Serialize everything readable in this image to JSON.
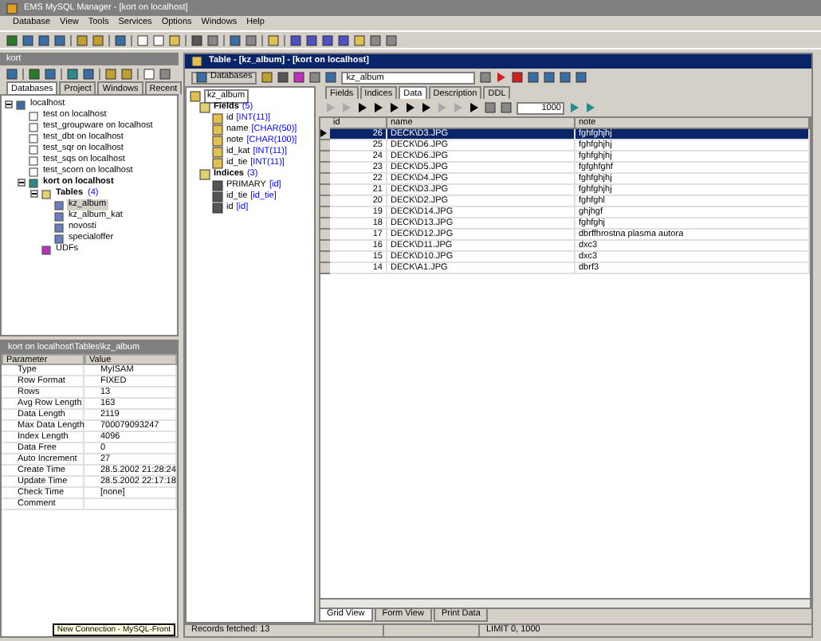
{
  "window": {
    "title": "EMS MySQL Manager - [kort on localhost]"
  },
  "menu": [
    "Database",
    "View",
    "Tools",
    "Services",
    "Options",
    "Windows",
    "Help"
  ],
  "explorer": {
    "title": "kort",
    "tabs": [
      {
        "label": "Databases",
        "selected": true
      },
      {
        "label": "Project",
        "selected": false
      },
      {
        "label": "Windows",
        "selected": false
      },
      {
        "label": "Recent",
        "selected": false
      }
    ],
    "tree": [
      {
        "label": "localhost",
        "kind": "host",
        "expanded": true,
        "selected": false,
        "children": [
          {
            "label": "test on localhost",
            "kind": "db",
            "selected": false
          },
          {
            "label": "test_groupware on localhost",
            "kind": "db",
            "selected": false
          },
          {
            "label": "test_dbt on localhost",
            "kind": "db",
            "selected": false
          },
          {
            "label": "test_sqr on localhost",
            "kind": "db",
            "selected": false
          },
          {
            "label": "test_sqs on localhost",
            "kind": "db",
            "selected": false
          },
          {
            "label": "test_scorn on localhost",
            "kind": "db",
            "selected": false
          },
          {
            "label": "kort on localhost",
            "kind": "active-db",
            "expanded": true,
            "selected": false,
            "children": [
              {
                "label": "Tables",
                "count": "(4)",
                "kind": "folder",
                "expanded": true,
                "selected": false,
                "children": [
                  {
                    "label": "kz_album",
                    "kind": "table",
                    "selected": true
                  },
                  {
                    "label": "kz_album_kat",
                    "kind": "table",
                    "selected": false
                  },
                  {
                    "label": "novosti",
                    "kind": "table",
                    "selected": false
                  },
                  {
                    "label": "specialoffer",
                    "kind": "table",
                    "selected": false
                  }
                ]
              },
              {
                "label": "UDFs",
                "kind": "udf",
                "selected": false
              }
            ]
          }
        ]
      }
    ]
  },
  "properties": {
    "title": "kort on localhost\\Tables\\kz_album",
    "columns": [
      "Parameter",
      "Value"
    ],
    "rows": [
      [
        "Type",
        "MyISAM"
      ],
      [
        "Row Format",
        "FIXED"
      ],
      [
        "Rows",
        "13"
      ],
      [
        "Avg Row Length",
        "163"
      ],
      [
        "Data Length",
        "2119"
      ],
      [
        "Max Data Length",
        "700079093247"
      ],
      [
        "Index Length",
        "4096"
      ],
      [
        "Data Free",
        "0"
      ],
      [
        "Auto Increment",
        "27"
      ],
      [
        "Create Time",
        "28.5.2002 21:28:24"
      ],
      [
        "Update Time",
        "28.5.2002 22:17:18"
      ],
      [
        "Check Time",
        "[none]"
      ],
      [
        "Comment",
        ""
      ]
    ]
  },
  "tooltip": "New Connection - MySQL-Front",
  "table_window": {
    "title": "Table - [kz_album] - [kort on localhost]",
    "databases_button": "Databases",
    "table_combo": "kz_album",
    "tree": {
      "label": "kz_album",
      "selected": true,
      "groups": [
        {
          "label": "Fields",
          "count": "(5)",
          "kind": "fields",
          "items": [
            {
              "name": "id",
              "type": "[INT(11)]"
            },
            {
              "name": "name",
              "type": "[CHAR(50)]"
            },
            {
              "name": "note",
              "type": "[CHAR(100)]"
            },
            {
              "name": "id_kat",
              "type": "[INT(11)]"
            },
            {
              "name": "id_tie",
              "type": "[INT(11)]"
            }
          ]
        },
        {
          "label": "Indices",
          "count": "(3)",
          "kind": "indices",
          "items": [
            {
              "name": "PRIMARY",
              "type": "[id]"
            },
            {
              "name": "id_tie",
              "type": "[id_tie]"
            },
            {
              "name": "id",
              "type": "[id]"
            }
          ]
        }
      ]
    },
    "tabs": [
      {
        "label": "Fields",
        "selected": false
      },
      {
        "label": "Indices",
        "selected": false
      },
      {
        "label": "Data",
        "selected": true
      },
      {
        "label": "Description",
        "selected": false
      },
      {
        "label": "DDL",
        "selected": false
      }
    ],
    "limit": "1000",
    "grid": {
      "columns": [
        "id",
        "name",
        "note"
      ],
      "rows": [
        {
          "cells": [
            "26",
            "DECK\\D3.JPG",
            "fghfghjhj"
          ],
          "selected": true
        },
        {
          "cells": [
            "25",
            "DECK\\D6.JPG",
            "fghfghjhj"
          ],
          "selected": false
        },
        {
          "cells": [
            "24",
            "DECK\\D6.JPG",
            "fghfghjhj"
          ],
          "selected": false
        },
        {
          "cells": [
            "23",
            "DECK\\D5.JPG",
            "fgfghfghf"
          ],
          "selected": false
        },
        {
          "cells": [
            "22",
            "DECK\\D4.JPG",
            "fghfghjhj"
          ],
          "selected": false
        },
        {
          "cells": [
            "21",
            "DECK\\D3.JPG",
            "fghfghjhj"
          ],
          "selected": false
        },
        {
          "cells": [
            "20",
            "DECK\\D2.JPG",
            "fghfghl"
          ],
          "selected": false
        },
        {
          "cells": [
            "19",
            "DECK\\D14.JPG",
            "ghjhgf"
          ],
          "selected": false
        },
        {
          "cells": [
            "18",
            "DECK\\D13.JPG",
            "fghfghj"
          ],
          "selected": false
        },
        {
          "cells": [
            "17",
            "DECK\\D12.JPG",
            "dbrffhrostna plasma autora"
          ],
          "selected": false
        },
        {
          "cells": [
            "16",
            "DECK\\D11.JPG",
            "dxc3"
          ],
          "selected": false
        },
        {
          "cells": [
            "15",
            "DECK\\D10.JPG",
            "dxc3"
          ],
          "selected": false
        },
        {
          "cells": [
            "14",
            "DECK\\A1.JPG",
            "dbrf3"
          ],
          "selected": false
        }
      ]
    },
    "view_tabs": [
      {
        "label": "Grid View",
        "selected": true
      },
      {
        "label": "Form View",
        "selected": false
      },
      {
        "label": "Print Data",
        "selected": false
      }
    ],
    "status": [
      "Records fetched: 13",
      "LIMIT 0, 1000"
    ]
  }
}
